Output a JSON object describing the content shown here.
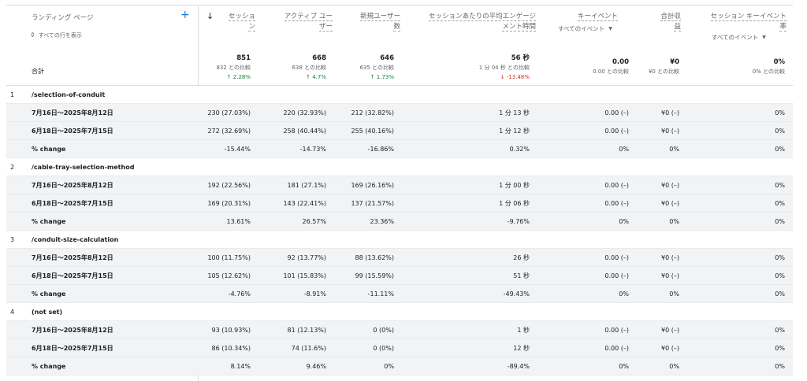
{
  "header": {
    "dimension": "ランディング ページ",
    "add_icon": "+",
    "show_rows": "すべての行を表示",
    "sort_icon": "↓",
    "col_sessions": [
      "セッショ",
      "ン"
    ],
    "col_active": [
      "アクティブ ユー",
      "ザー"
    ],
    "col_new": [
      "新規ユーザー",
      "数"
    ],
    "col_engage": [
      "セッションあたりの平均エンゲージ",
      "メント時間"
    ],
    "col_keyevent": "キーイベント",
    "col_keyevent_filter": "すべてのイベント",
    "col_revenue": [
      "合計収",
      "益"
    ],
    "col_rate": [
      "セッション キーイベント",
      "率"
    ],
    "col_rate_filter": "すべてのイベント"
  },
  "totals": {
    "label": "合計",
    "sessions": {
      "value": "851",
      "compare": "832 との比較",
      "change": "↑ 2.28%"
    },
    "active": {
      "value": "668",
      "compare": "638 との比較",
      "change": "↑ 4.7%"
    },
    "new": {
      "value": "646",
      "compare": "635 との比較",
      "change": "↑ 1.73%"
    },
    "engage": {
      "value": "56 秒",
      "compare": "1 分 04 秒 との比較",
      "change": "↓ -13.48%"
    },
    "keyevent": {
      "value": "0.00",
      "compare": "0.00 との比較"
    },
    "revenue": {
      "value": "¥0",
      "compare": "¥0 との比較"
    },
    "rate": {
      "value": "0%",
      "compare": "0% との比較"
    }
  },
  "rows": [
    {
      "type": "group",
      "idx": "1",
      "label": "/selection-of-conduit"
    },
    {
      "type": "data",
      "label": "7月16日～2025年8月12日",
      "sessions": "230 (27.03%)",
      "active": "220 (32.93%)",
      "new": "212 (32.82%)",
      "engage": "1 分 13 秒",
      "keyevent": "0.00 (–)",
      "revenue": "¥0 (–)",
      "rate": "0%"
    },
    {
      "type": "data",
      "label": "6月18日～2025年7月15日",
      "sessions": "272 (32.69%)",
      "active": "258 (40.44%)",
      "new": "255 (40.16%)",
      "engage": "1 分 12 秒",
      "keyevent": "0.00 (–)",
      "revenue": "¥0 (–)",
      "rate": "0%"
    },
    {
      "type": "change",
      "label": "% change",
      "sessions": "-15.44%",
      "active": "-14.73%",
      "new": "-16.86%",
      "engage": "0.32%",
      "keyevent": "0%",
      "revenue": "0%",
      "rate": "0%"
    },
    {
      "type": "group",
      "idx": "2",
      "label": "/cable-tray-selection-method"
    },
    {
      "type": "data",
      "label": "7月16日～2025年8月12日",
      "sessions": "192 (22.56%)",
      "active": "181 (27.1%)",
      "new": "169 (26.16%)",
      "engage": "1 分 00 秒",
      "keyevent": "0.00 (–)",
      "revenue": "¥0 (–)",
      "rate": "0%"
    },
    {
      "type": "data",
      "label": "6月18日～2025年7月15日",
      "sessions": "169 (20.31%)",
      "active": "143 (22.41%)",
      "new": "137 (21.57%)",
      "engage": "1 分 06 秒",
      "keyevent": "0.00 (–)",
      "revenue": "¥0 (–)",
      "rate": "0%"
    },
    {
      "type": "change",
      "label": "% change",
      "sessions": "13.61%",
      "active": "26.57%",
      "new": "23.36%",
      "engage": "-9.76%",
      "keyevent": "0%",
      "revenue": "0%",
      "rate": "0%"
    },
    {
      "type": "group",
      "idx": "3",
      "label": "/conduit-size-calculation"
    },
    {
      "type": "data",
      "label": "7月16日～2025年8月12日",
      "sessions": "100 (11.75%)",
      "active": "92 (13.77%)",
      "new": "88 (13.62%)",
      "engage": "26 秒",
      "keyevent": "0.00 (–)",
      "revenue": "¥0 (–)",
      "rate": "0%"
    },
    {
      "type": "data",
      "label": "6月18日～2025年7月15日",
      "sessions": "105 (12.62%)",
      "active": "101 (15.83%)",
      "new": "99 (15.59%)",
      "engage": "51 秒",
      "keyevent": "0.00 (–)",
      "revenue": "¥0 (–)",
      "rate": "0%"
    },
    {
      "type": "change",
      "label": "% change",
      "sessions": "-4.76%",
      "active": "-8.91%",
      "new": "-11.11%",
      "engage": "-49.43%",
      "keyevent": "0%",
      "revenue": "0%",
      "rate": "0%"
    },
    {
      "type": "group",
      "idx": "4",
      "label": "(not set)"
    },
    {
      "type": "data",
      "label": "7月16日～2025年8月12日",
      "sessions": "93 (10.93%)",
      "active": "81 (12.13%)",
      "new": "0 (0%)",
      "engage": "1 秒",
      "keyevent": "0.00 (–)",
      "revenue": "¥0 (–)",
      "rate": "0%"
    },
    {
      "type": "data",
      "label": "6月18日～2025年7月15日",
      "sessions": "86 (10.34%)",
      "active": "74 (11.6%)",
      "new": "0 (0%)",
      "engage": "12 秒",
      "keyevent": "0.00 (–)",
      "revenue": "¥0 (–)",
      "rate": "0%"
    },
    {
      "type": "change",
      "label": "% change",
      "sessions": "8.14%",
      "active": "9.46%",
      "new": "0%",
      "engage": "-89.4%",
      "keyevent": "0%",
      "revenue": "0%",
      "rate": "0%"
    }
  ]
}
